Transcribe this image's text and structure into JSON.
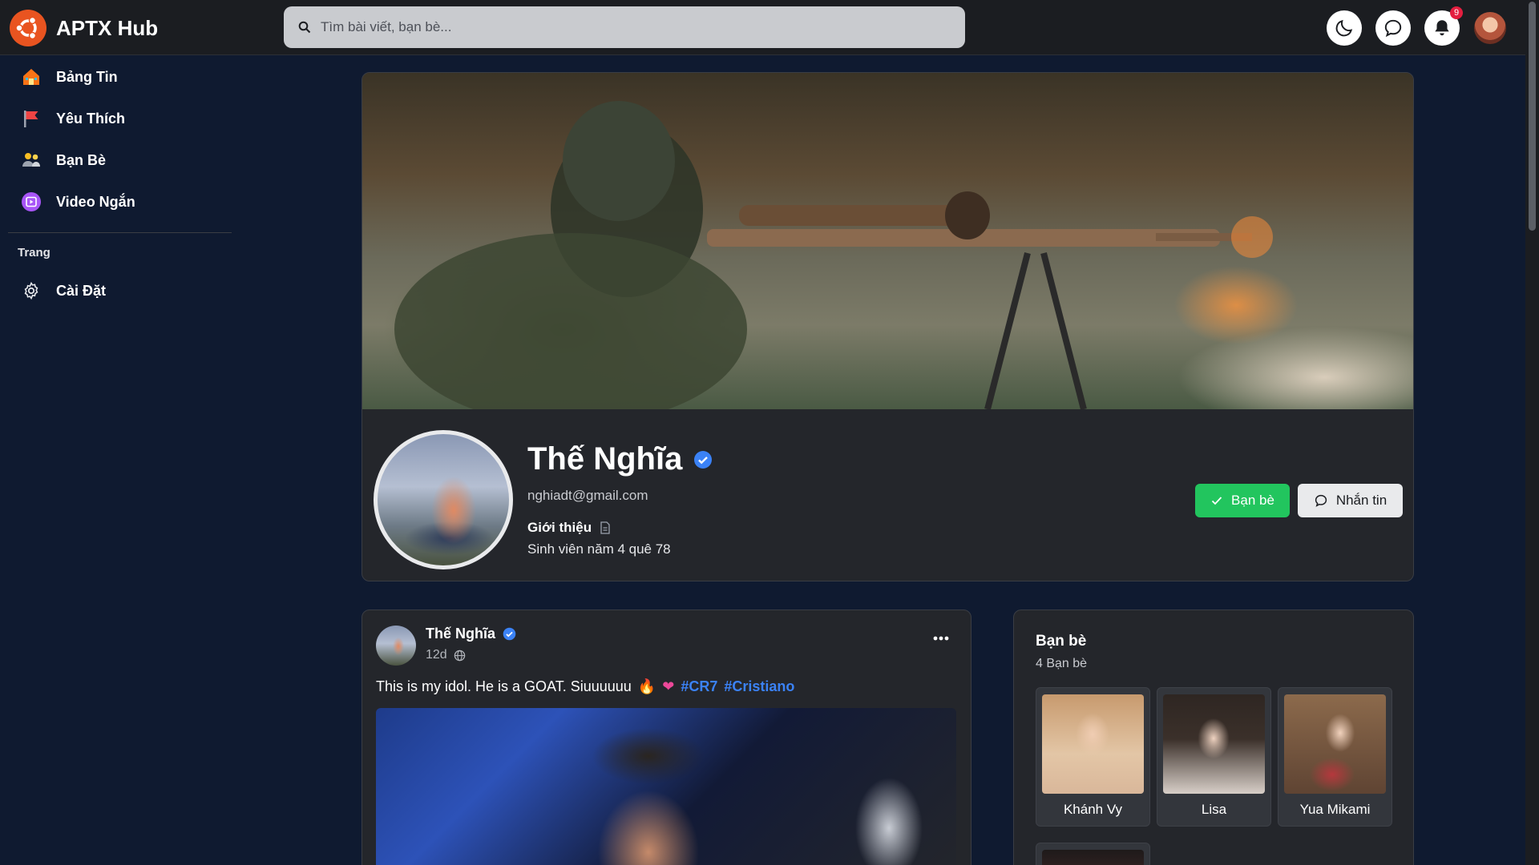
{
  "header": {
    "brand": "APTX Hub",
    "logo_icon": "ubuntu-logo-icon",
    "search_placeholder": "Tìm bài viết, bạn bè...",
    "notification_count": "9",
    "actions": [
      "moon-icon",
      "chat-icon",
      "bell-icon",
      "avatar"
    ]
  },
  "sidebar": {
    "items": [
      {
        "label": "Bảng Tin",
        "icon": "home-icon"
      },
      {
        "label": "Yêu Thích",
        "icon": "flag-icon"
      },
      {
        "label": "Bạn Bè",
        "icon": "friends-icon"
      },
      {
        "label": "Video Ngắn",
        "icon": "video-icon"
      }
    ],
    "section_title": "Trang",
    "section_items": [
      {
        "label": "Cài Đặt",
        "icon": "gear-icon"
      }
    ]
  },
  "profile": {
    "name": "Thế Nghĩa",
    "verified": true,
    "email": "nghiadt@gmail.com",
    "intro_label": "Giới thiệu",
    "intro_text": "Sinh viên năm 4 quê 78",
    "friend_button": "Bạn bè",
    "message_button": "Nhắn tin"
  },
  "post": {
    "author": "Thế Nghĩa",
    "time": "12d",
    "privacy_icon": "globe-icon",
    "text": "This is my idol. He is a GOAT. Siuuuuuu",
    "emojis": [
      "🔥",
      "❤"
    ],
    "hashtags": [
      "#CR7",
      "#Cristiano"
    ]
  },
  "friends": {
    "title": "Bạn bè",
    "count_label": "4 Bạn bè",
    "list": [
      {
        "name": "Khánh Vy"
      },
      {
        "name": "Lisa"
      },
      {
        "name": "Yua Mikami"
      }
    ]
  },
  "colors": {
    "page_bg": "#0f1a30",
    "card_bg": "#24262b",
    "header_bg": "#1b1d21",
    "accent_green": "#22c55e",
    "hashtag_blue": "#3b82f6",
    "verified_blue": "#3b82f6",
    "brand_orange": "#e95420"
  }
}
